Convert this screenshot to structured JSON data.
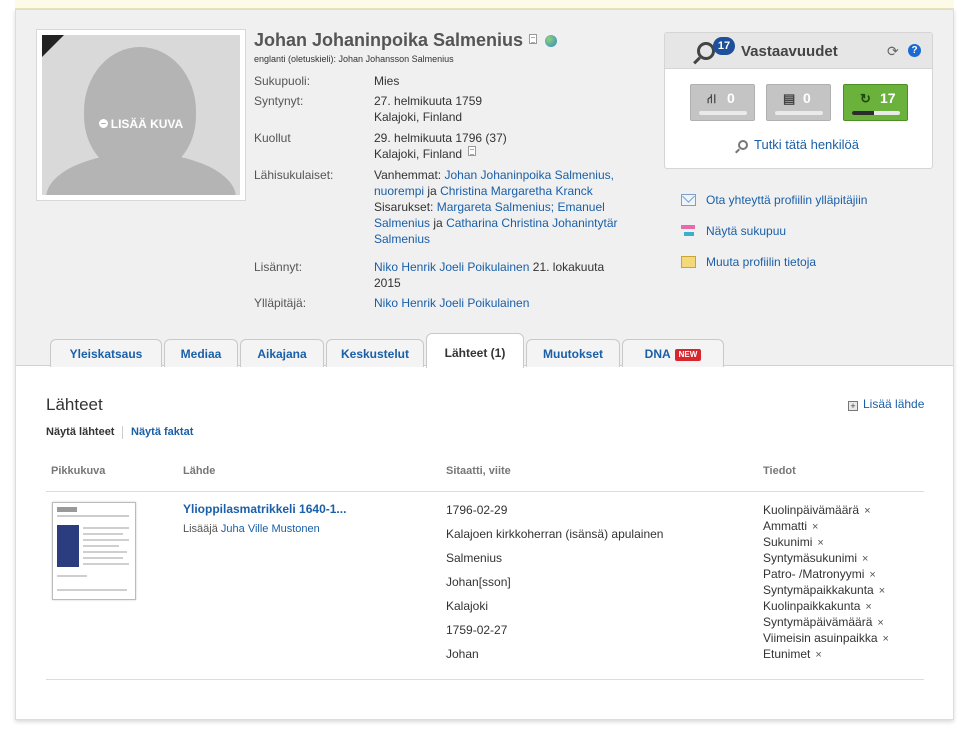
{
  "profile": {
    "name": "Johan Johaninpoika Salmenius",
    "subname": "englanti (oletuskieli): Johan Johansson Salmenius",
    "add_photo": "LISÄÄ KUVA",
    "facts": [
      {
        "label": "Sukupuoli:",
        "value": "Mies"
      },
      {
        "label": "Syntynyt:",
        "line1": "27. helmikuuta 1759",
        "line2": "Kalajoki, Finland"
      },
      {
        "label": "Kuollut",
        "line1": "29. helmikuuta 1796 (37)",
        "line2": "Kalajoki, Finland"
      },
      {
        "label": "Lähisukulaiset:"
      },
      {
        "label": "Lisännyt:"
      },
      {
        "label": "Ylläpitäjä:"
      }
    ],
    "relatives": {
      "parents_label": "Vanhemmat:",
      "parent1": "Johan Johaninpoika Salmenius,",
      "parent1b": "nuorempi",
      "and1": "ja",
      "parent2": "Christina Margaretha Kranck",
      "siblings_label": "Sisarukset:",
      "sibling1": "Margareta Salmenius;",
      "sibling2a": "Emanuel",
      "sibling2b": "Salmenius",
      "and2": "ja",
      "sibling3a": "Catharina Christina Johanintytär",
      "sibling3b": "Salmenius"
    },
    "added_by": "Niko Henrik Joeli Poikulainen",
    "added_date_a": "21. lokakuuta",
    "added_date_b": "2015",
    "manager": "Niko Henrik Joeli Poikulainen"
  },
  "matches": {
    "badge": "17",
    "title": "Vastaavuudet",
    "help": "?",
    "buttons": [
      {
        "icon": "⛙",
        "count": "0",
        "bar_fraction": 0
      },
      {
        "icon": "▤",
        "count": "0",
        "bar_fraction": 0
      },
      {
        "icon": "↻",
        "count": "17",
        "bar_fraction": 0.45
      }
    ],
    "explore": "Tutki tätä henkilöä"
  },
  "side_actions": [
    "Ota yhteyttä profiilin ylläpitäjiin",
    "Näytä sukupuu",
    "Muuta profiilin tietoja"
  ],
  "tabs": [
    {
      "label": "Yleiskatsaus"
    },
    {
      "label": "Mediaa"
    },
    {
      "label": "Aikajana"
    },
    {
      "label": "Keskustelut"
    },
    {
      "label": "Lähteet (1)"
    },
    {
      "label": "Muutokset"
    },
    {
      "label": "DNA",
      "badge": "NEW"
    }
  ],
  "sources": {
    "title": "Lähteet",
    "add": "Lisää lähde",
    "subtabs": [
      "Näytä lähteet",
      "Näytä faktat"
    ],
    "columns": [
      "Pikkukuva",
      "Lähde",
      "Sitaatti, viite",
      "Tiedot"
    ],
    "row": {
      "source_title": "Ylioppilasmatrikkeli 1640-1...",
      "added_label": "Lisääjä",
      "added_by": "Juha Ville Mustonen",
      "citations": [
        "1796-02-29",
        "Kalajoen kirkkoherran (isänsä) apulainen",
        "Salmenius",
        "Johan[sson]",
        "Kalajoki",
        "1759-02-27",
        "Johan"
      ],
      "facts": [
        "Kuolinpäivämäärä",
        "Ammatti",
        "Sukunimi",
        "Syntymäsukunimi",
        "Patro- /Matronyymi",
        "Syntymäpaikkakunta",
        "Kuolinpaikkakunta",
        "Syntymäpäivämäärä",
        "Viimeisin asuinpaikka",
        "Etunimet"
      ],
      "remove_glyph": "×"
    }
  }
}
